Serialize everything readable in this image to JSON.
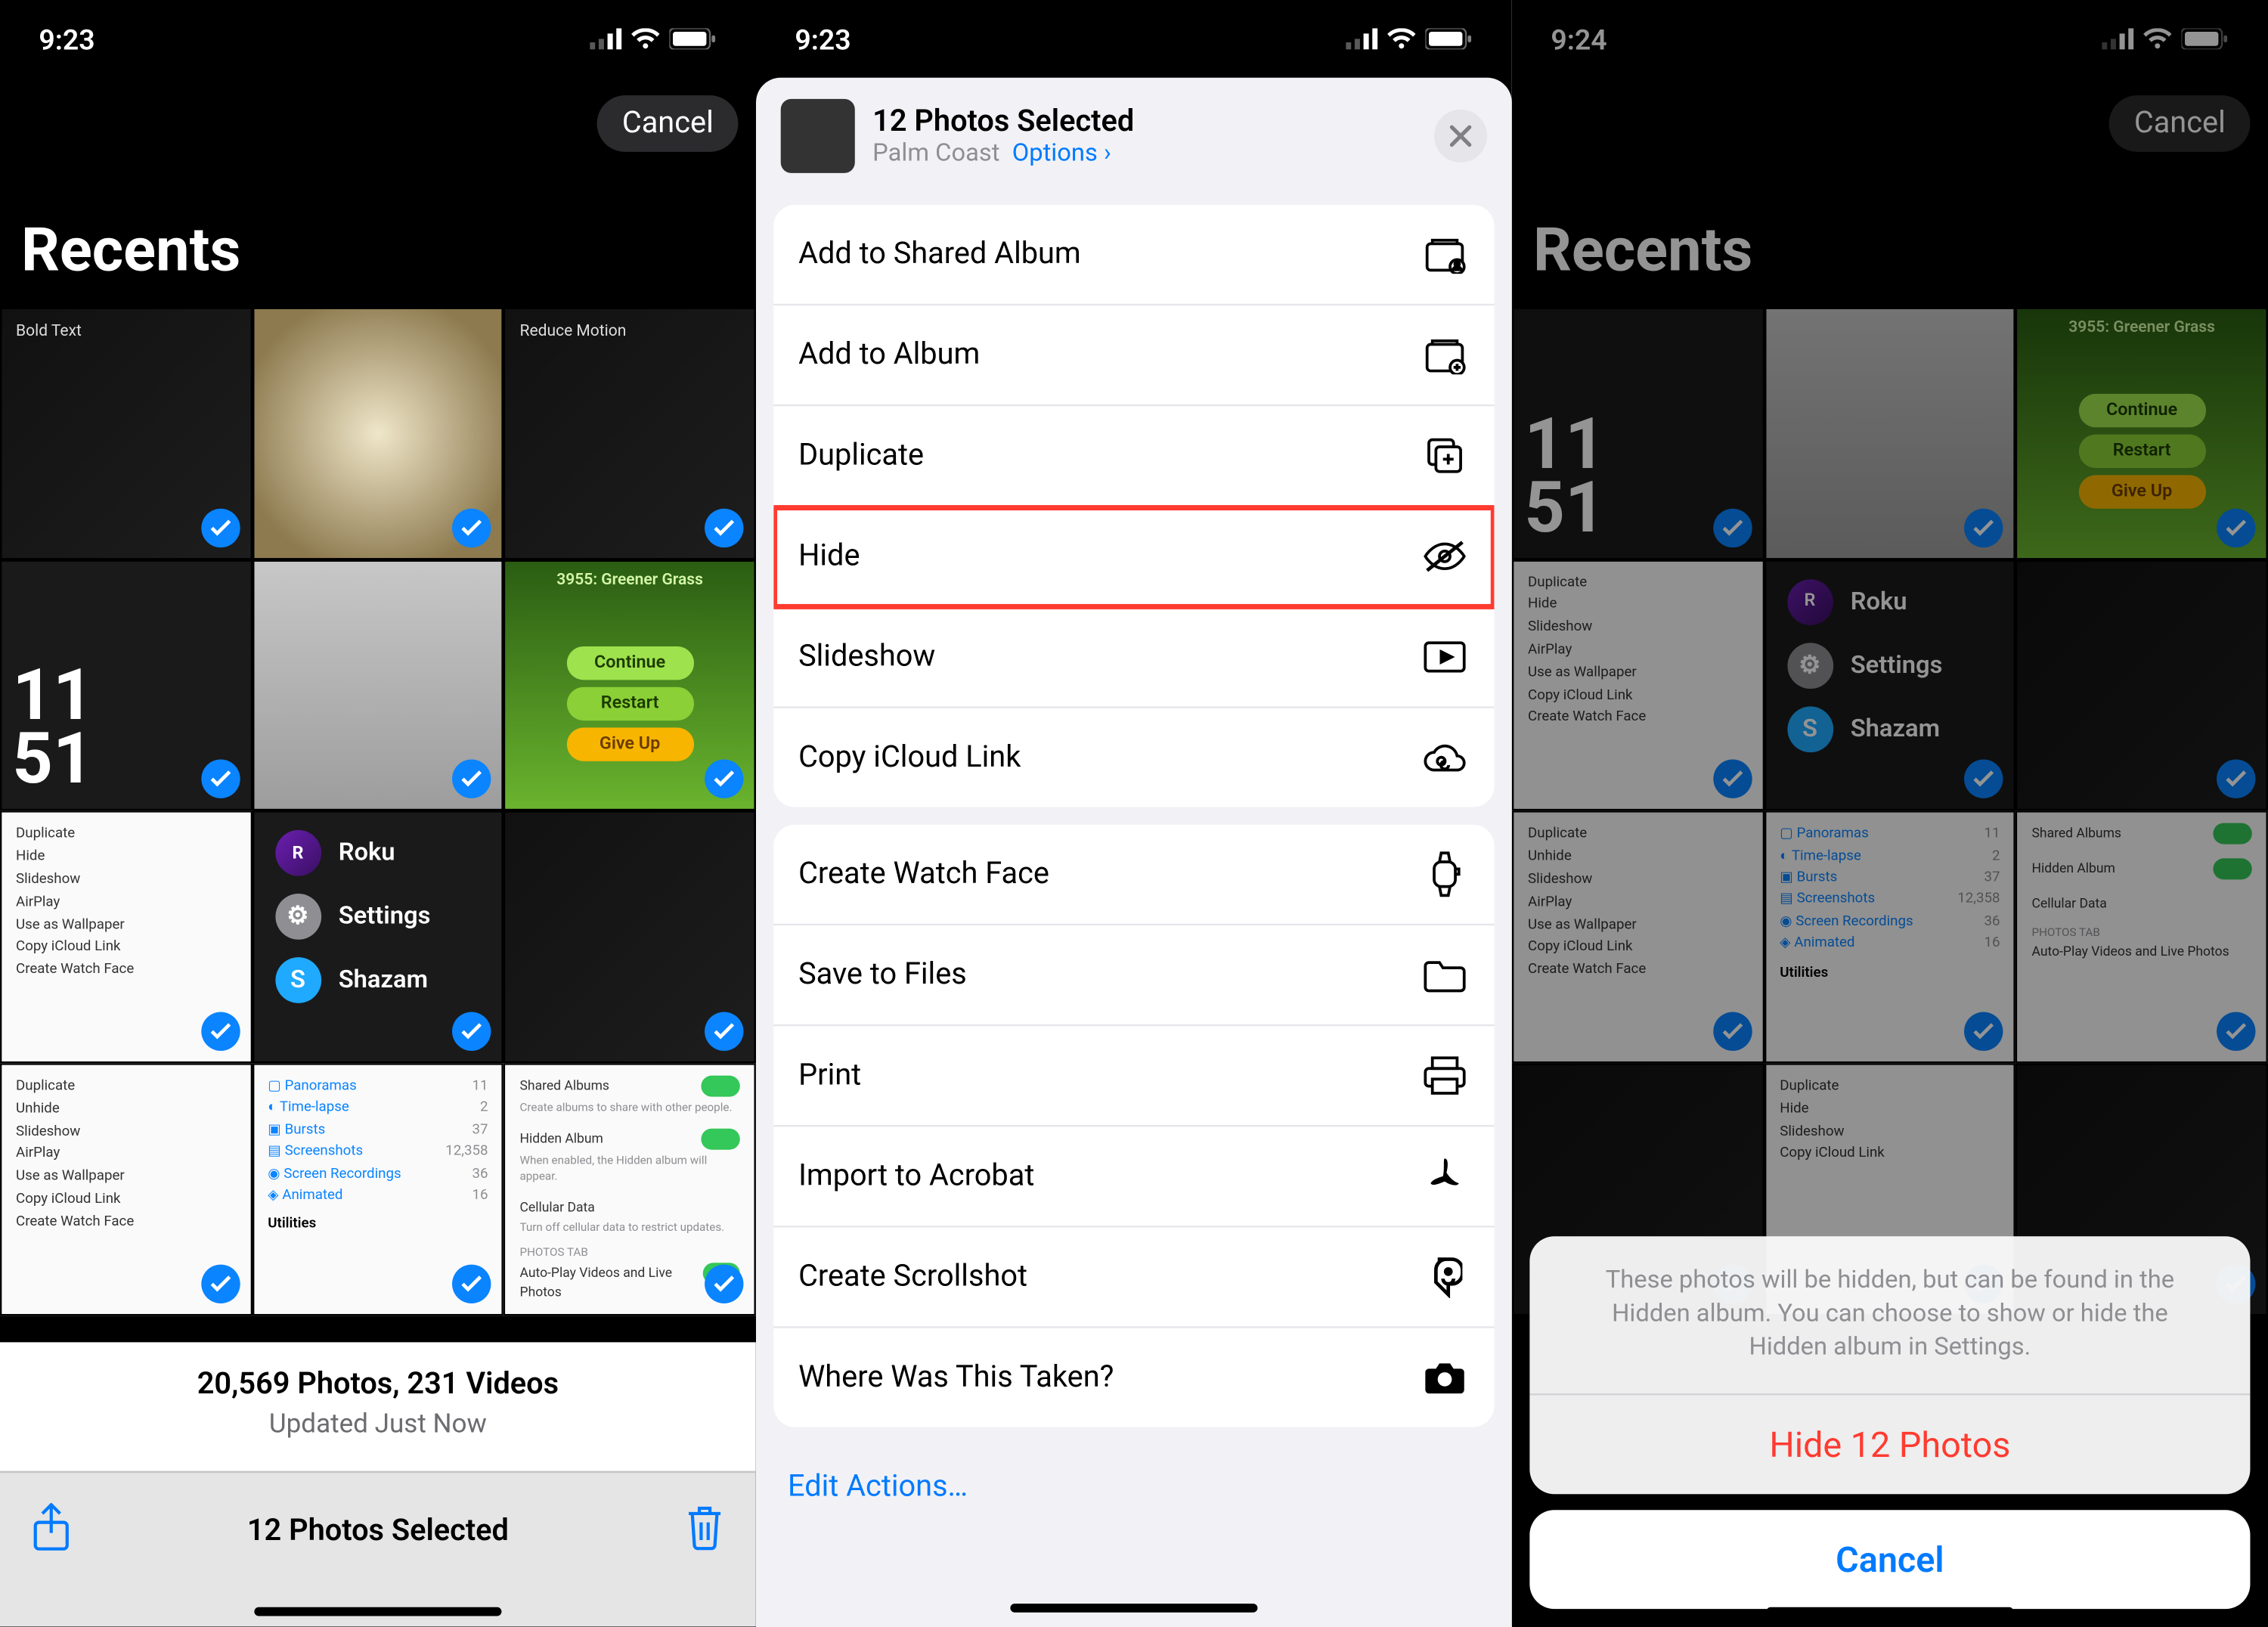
{
  "colors": {
    "accent": "#007aff",
    "danger": "#ff3b30",
    "check": "#0a84ff"
  },
  "p1": {
    "time": "9:23",
    "cancel": "Cancel",
    "title": "Recents",
    "count_line": "20,569 Photos, 231 Videos",
    "updated": "Updated Just Now",
    "toolbar_label": "12 Photos Selected"
  },
  "p2": {
    "time": "9:23",
    "title": "12 Photos Selected",
    "subtitle": "Palm Coast",
    "options": "Options",
    "group1": [
      {
        "label": "Add to Shared Album",
        "icon": "shared-album"
      },
      {
        "label": "Add to Album",
        "icon": "album"
      },
      {
        "label": "Duplicate",
        "icon": "duplicate"
      },
      {
        "label": "Hide",
        "icon": "hide",
        "hl": true
      },
      {
        "label": "Slideshow",
        "icon": "play"
      },
      {
        "label": "Copy iCloud Link",
        "icon": "cloud"
      }
    ],
    "group2": [
      {
        "label": "Create Watch Face",
        "icon": "watch"
      },
      {
        "label": "Save to Files",
        "icon": "folder"
      },
      {
        "label": "Print",
        "icon": "print"
      },
      {
        "label": "Import to Acrobat",
        "icon": "acrobat"
      },
      {
        "label": "Create Scrollshot",
        "icon": "scrollshot"
      },
      {
        "label": "Where Was This Taken?",
        "icon": "camera"
      }
    ],
    "edit": "Edit Actions…"
  },
  "p3": {
    "time": "9:24",
    "cancel_pill": "Cancel",
    "title": "Recents",
    "message": "These photos will be hidden, but can be found in the Hidden album. You can choose to show or hide the Hidden album in Settings.",
    "action": "Hide 12 Photos",
    "cancel": "Cancel"
  },
  "thumbs": {
    "bignum_top": "11",
    "bignum_bot": "51",
    "green_title": "3955: Greener Grass",
    "green_continue": "Continue",
    "green_restart": "Restart",
    "green_giveup": "Give Up",
    "roku": "Roku",
    "settings": "Settings",
    "shazam": "Shazam",
    "panoramas": "Panoramas",
    "panoramas_n": "11",
    "timelapse": "Time-lapse",
    "timelapse_n": "2",
    "bursts": "Bursts",
    "bursts_n": "37",
    "screenshots": "Screenshots",
    "screenshots_n": "12,358",
    "screcord": "Screen Recordings",
    "screcord_n": "36",
    "animated": "Animated",
    "animated_n": "16",
    "utilities": "Utilities",
    "shared_albums": "Shared Albums",
    "hidden_album": "Hidden Album",
    "cellular_data": "Cellular Data",
    "photos_tab": "PHOTOS TAB",
    "autoplay": "Auto-Play Videos and Live Photos",
    "opt_duplicate": "Duplicate",
    "opt_hide": "Hide",
    "opt_unhide": "Unhide",
    "opt_slideshow": "Slideshow",
    "opt_airplay": "AirPlay",
    "opt_wallpaper": "Use as Wallpaper",
    "opt_icloud": "Copy iCloud Link",
    "opt_watchface": "Create Watch Face"
  }
}
